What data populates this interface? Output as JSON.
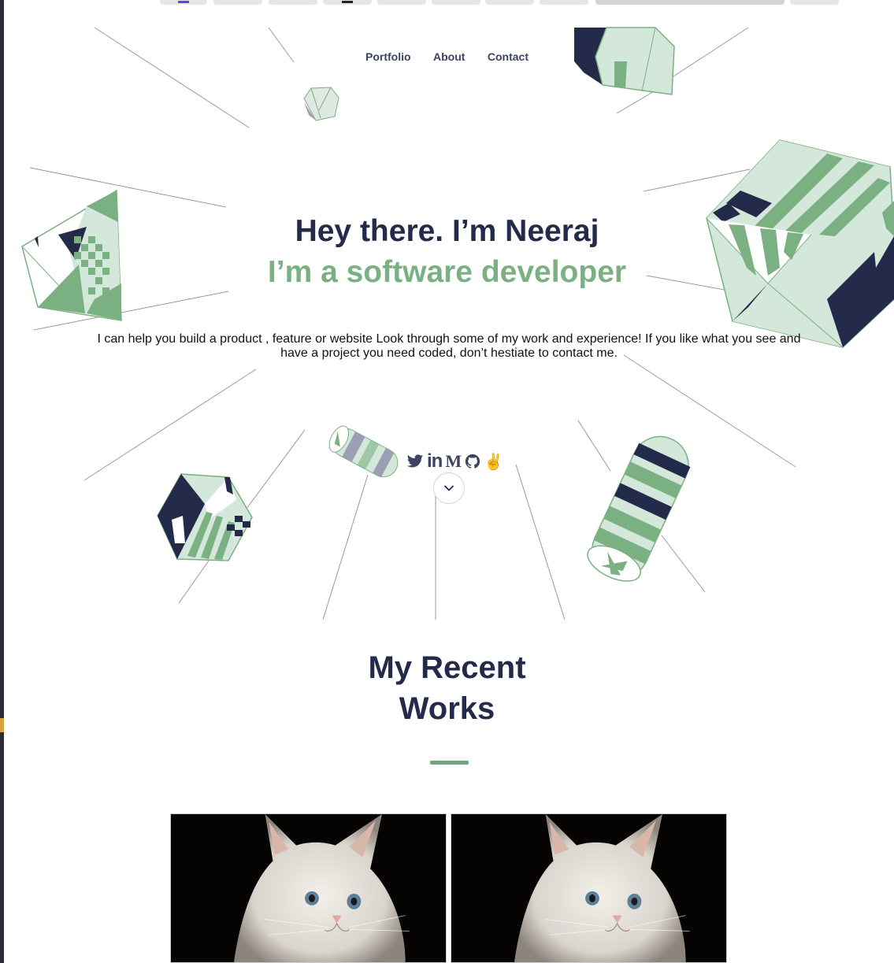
{
  "nav": {
    "items": [
      {
        "label": "Portfolio"
      },
      {
        "label": "About"
      },
      {
        "label": "Contact"
      }
    ]
  },
  "hero": {
    "title": "Hey there. I’m Neeraj",
    "subtitle": "I’m a software developer",
    "description": "I can help you build a product , feature or website Look through some of my work and experience! If you like what you see and have a project you need coded, don’t hestiate to contact me."
  },
  "social": {
    "icons": [
      "twitter-icon",
      "linkedin-icon",
      "medium-icon",
      "github-icon",
      "angellist-icon"
    ],
    "linkedin_text": "in",
    "medium_text": "M"
  },
  "works": {
    "title_line1": "My Recent",
    "title_line2": "Works",
    "cards": [
      {
        "image": "kitten-photo"
      },
      {
        "image": "kitten-photo"
      }
    ]
  },
  "colors": {
    "navy": "#242a4a",
    "green": "#7bb083",
    "light_green": "#d3e8da",
    "accent_rule": "#6fa57a"
  }
}
